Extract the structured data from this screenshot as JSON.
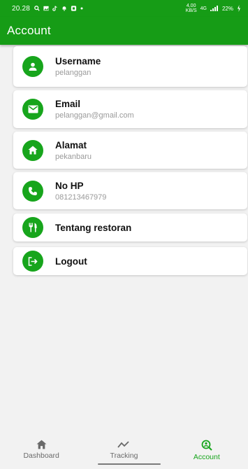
{
  "status_bar": {
    "time": "20.28",
    "network_speed_value": "4,00",
    "network_speed_unit": "KB/S",
    "network_type": "4G",
    "battery": "22%",
    "icons": [
      "search-icon",
      "gallery-icon",
      "tiktok-icon",
      "notification-icon",
      "app-icon",
      "dot-icon",
      "signal-icon",
      "battery-icon"
    ]
  },
  "app_bar": {
    "title": "Account"
  },
  "accent_color": "#17a51c",
  "items": [
    {
      "title": "Username",
      "subtitle": "pelanggan",
      "icon": "person-icon"
    },
    {
      "title": "Email",
      "subtitle": "pelanggan@gmail.com",
      "icon": "email-icon"
    },
    {
      "title": "Alamat",
      "subtitle": "pekanbaru",
      "icon": "home-icon"
    },
    {
      "title": "No HP",
      "subtitle": "081213467979",
      "icon": "phone-icon"
    },
    {
      "title": "Tentang restoran",
      "icon": "restaurant-icon"
    },
    {
      "title": "Logout",
      "icon": "logout-icon"
    }
  ],
  "bottom_nav": [
    {
      "label": "Dashboard",
      "icon": "home-icon",
      "active": false
    },
    {
      "label": "Tracking",
      "icon": "trending-icon",
      "active": false
    },
    {
      "label": "Account",
      "icon": "account-search-icon",
      "active": true
    }
  ]
}
